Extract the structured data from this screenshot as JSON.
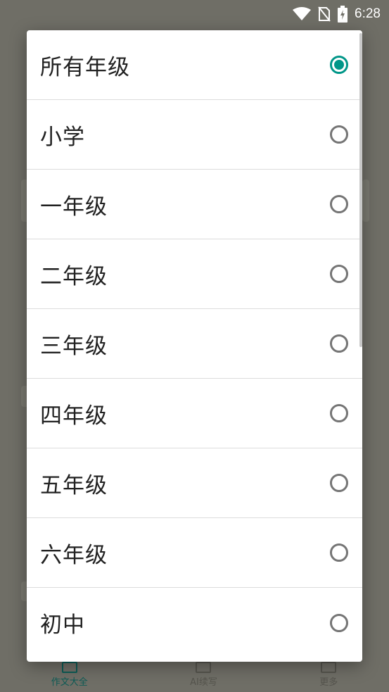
{
  "status_bar": {
    "time": "6:28",
    "icons": [
      "wifi-icon",
      "no-sim-icon",
      "battery-charging-icon"
    ]
  },
  "background": {
    "bottom_nav": [
      {
        "label": "作文大全",
        "icon": "document-icon",
        "active": true
      },
      {
        "label": "AI续写",
        "icon": "ai-icon",
        "active": false
      },
      {
        "label": "更多",
        "icon": "grid-icon",
        "active": false
      }
    ]
  },
  "dialog": {
    "options": [
      {
        "label": "所有年级",
        "selected": true
      },
      {
        "label": "小学",
        "selected": false
      },
      {
        "label": "一年级",
        "selected": false
      },
      {
        "label": "二年级",
        "selected": false
      },
      {
        "label": "三年级",
        "selected": false
      },
      {
        "label": "四年级",
        "selected": false
      },
      {
        "label": "五年级",
        "selected": false
      },
      {
        "label": "六年级",
        "selected": false
      },
      {
        "label": "初中",
        "selected": false
      }
    ]
  },
  "colors": {
    "accent": "#009688",
    "scrim": "#6f6e66",
    "radio_unchecked": "#757575"
  }
}
